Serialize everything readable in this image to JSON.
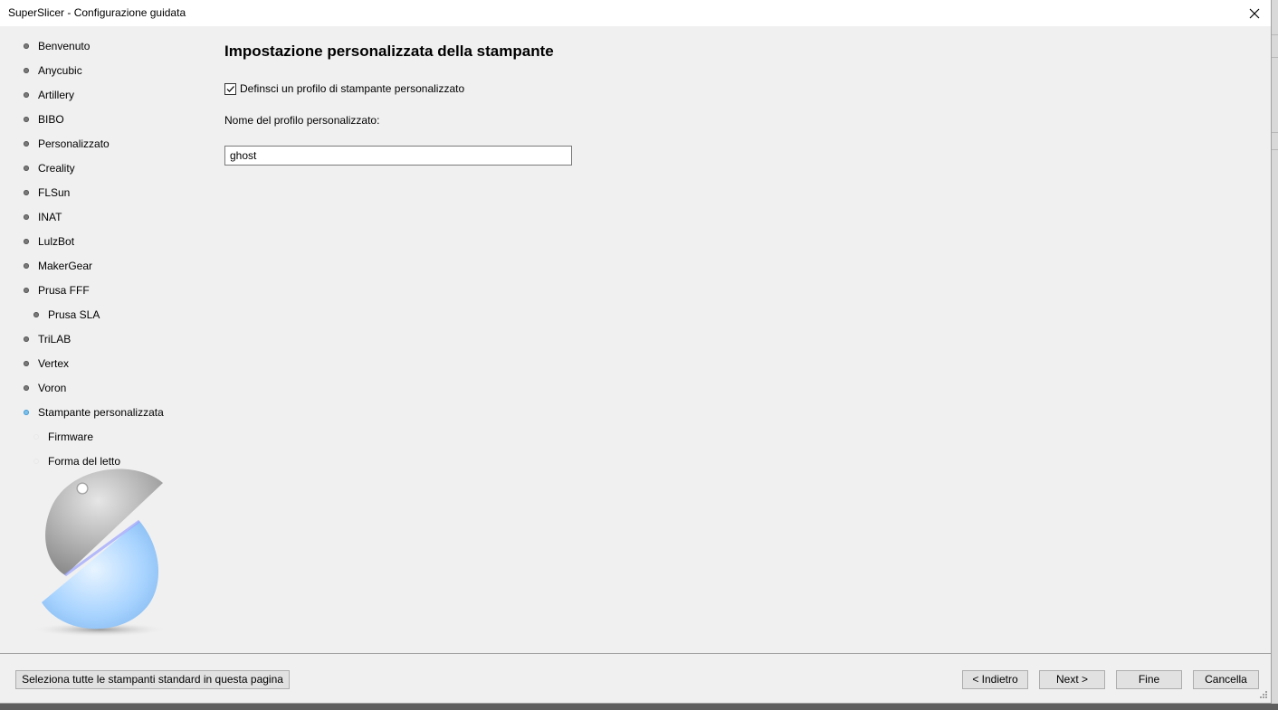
{
  "window": {
    "title": "SuperSlicer - Configurazione guidata"
  },
  "sidebar": {
    "items": [
      {
        "label": "Benvenuto",
        "state": "done",
        "level": 0
      },
      {
        "label": "Anycubic",
        "state": "done",
        "level": 0
      },
      {
        "label": "Artillery",
        "state": "done",
        "level": 0
      },
      {
        "label": "BIBO",
        "state": "done",
        "level": 0
      },
      {
        "label": "Personalizzato",
        "state": "done",
        "level": 0
      },
      {
        "label": "Creality",
        "state": "done",
        "level": 0
      },
      {
        "label": "FLSun",
        "state": "done",
        "level": 0
      },
      {
        "label": "INAT",
        "state": "done",
        "level": 0
      },
      {
        "label": "LulzBot",
        "state": "done",
        "level": 0
      },
      {
        "label": "MakerGear",
        "state": "done",
        "level": 0
      },
      {
        "label": "Prusa FFF",
        "state": "done",
        "level": 0
      },
      {
        "label": "Prusa SLA",
        "state": "done",
        "level": 1
      },
      {
        "label": "TriLAB",
        "state": "done",
        "level": 0
      },
      {
        "label": "Vertex",
        "state": "done",
        "level": 0
      },
      {
        "label": "Voron",
        "state": "done",
        "level": 0
      },
      {
        "label": "Stampante personalizzata",
        "state": "active",
        "level": 0
      },
      {
        "label": "Firmware",
        "state": "pending",
        "level": 1
      },
      {
        "label": "Forma del letto",
        "state": "pending",
        "level": 1
      }
    ]
  },
  "main": {
    "title": "Impostazione personalizzata della stampante",
    "checkbox_label": "Definsci un profilo di stampante personalizzato",
    "checkbox_checked": true,
    "name_label": "Nome del profilo personalizzato:",
    "name_value": "ghost"
  },
  "footer": {
    "select_all_label": "Seleziona tutte le stampanti standard in questa pagina",
    "back_label": "< Indietro",
    "next_label": "Next >",
    "finish_label": "Fine",
    "cancel_label": "Cancella"
  },
  "colors": {
    "active_bullet": "#7ec0ea",
    "done_bullet": "#7a7a7a",
    "background": "#f0f0f0"
  },
  "icons": {
    "close": "close-icon",
    "logo": "superslicer-logo",
    "check": "checkmark-icon",
    "grip": "resize-grip-icon"
  }
}
